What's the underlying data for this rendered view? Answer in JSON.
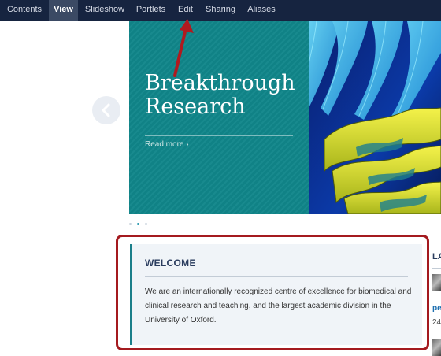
{
  "toolbar": {
    "items": [
      {
        "label": "Contents",
        "active": false
      },
      {
        "label": "View",
        "active": true
      },
      {
        "label": "Slideshow",
        "active": false
      },
      {
        "label": "Portlets",
        "active": false
      },
      {
        "label": "Edit",
        "active": false
      },
      {
        "label": "Sharing",
        "active": false
      },
      {
        "label": "Aliases",
        "active": false
      }
    ]
  },
  "carousel": {
    "title_line1": "Breakthrough",
    "title_line2": "Research",
    "read_more": "Read more ›",
    "prev_icon": "chevron-left-icon",
    "slide_count": 3,
    "active_slide": 2
  },
  "welcome": {
    "title": "WELCOME",
    "body": "We are an internationally recognized centre of excellence for biomedical and clinical research and teaching, and the largest academic division in the University of Oxford."
  },
  "right_column": {
    "heading": "LA",
    "link_fragment": "pe",
    "date_fragment": "24"
  },
  "annotation": {
    "arrow_color": "#b01a1f",
    "highlight_color": "#a41a1f"
  }
}
